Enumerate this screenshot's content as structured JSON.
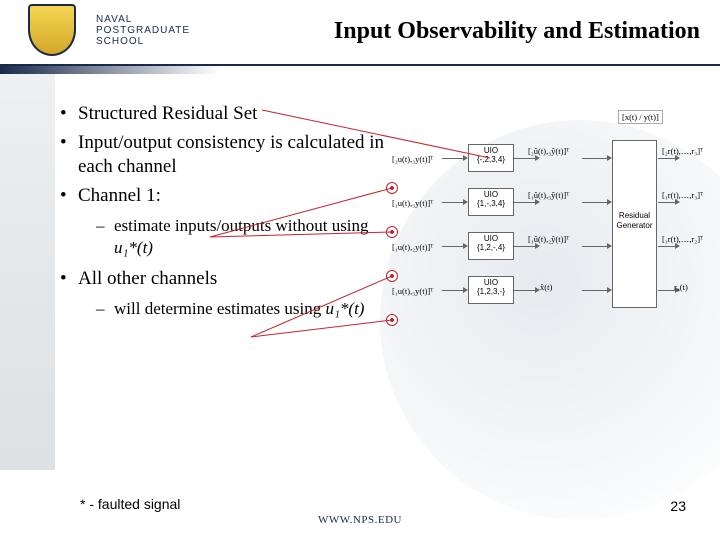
{
  "header": {
    "org_line1": "NAVAL",
    "org_line2": "POSTGRADUATE",
    "org_line3": "SCHOOL",
    "title": "Input Observability and Estimation"
  },
  "bullets": {
    "b1": "Structured Residual Set",
    "b2": "Input/output consistency is calculated in each channel",
    "b3": "Channel 1:",
    "b3_sub_prefix": "estimate inputs/outputs without using ",
    "b3_sub_math": "u₁*(t)",
    "b4": "All other channels",
    "b4_sub_prefix": "will determine estimates using ",
    "b4_sub_math": "u₁*(t)"
  },
  "diagram": {
    "top_label": "[x(t) / y(t)]",
    "inputs": [
      "[₂u(t),₃y(t)]ᵀ",
      "[₁u(t),₃y(t)]ᵀ",
      "[₁u(t),₂y(t)]ᵀ",
      "[₁u(t),₃y(t)]ᵀ"
    ],
    "uio": [
      {
        "name": "UIO",
        "idx": "{-,2,3,4}"
      },
      {
        "name": "UIO",
        "idx": "{1,-,3,4}"
      },
      {
        "name": "UIO",
        "idx": "{1,2,-,4}"
      },
      {
        "name": "UIO",
        "idx": "{1,2,3,-}"
      }
    ],
    "mids": [
      "[₂û(t),₃ŷ(t)]ᵀ",
      "[₁û(t),₃ŷ(t)]ᵀ",
      "[₁û(t),₂ŷ(t)]ᵀ",
      "x̂(t)"
    ],
    "resgen": "Residual Generator",
    "outputs": [
      "[₂r(t),…,r₃]ᵀ",
      "[₁r(t),…,r₃]ᵀ",
      "[₁r(t),…,r₂]ᵀ",
      "r₄(t)"
    ]
  },
  "footnote": "* - faulted signal",
  "footer_url": "WWW.NPS.EDU",
  "slide_num": "23"
}
